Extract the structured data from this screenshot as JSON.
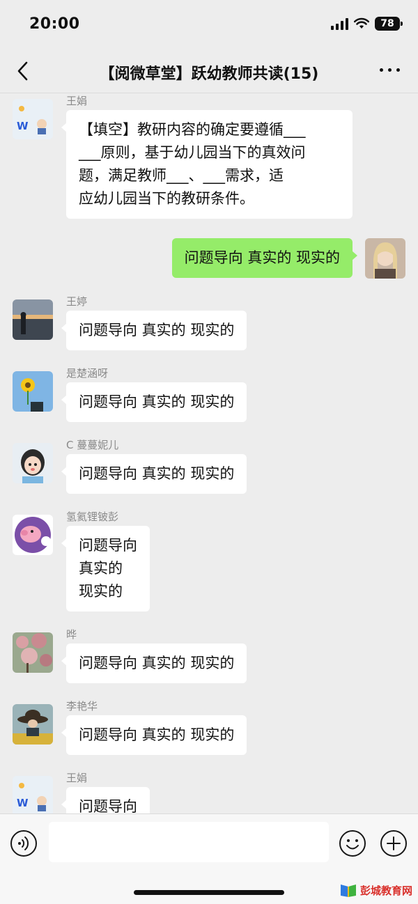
{
  "status_bar": {
    "time": "20:00",
    "battery": "78"
  },
  "nav": {
    "title": "【阅微草堂】跃幼教师共读(15)"
  },
  "messages": [
    {
      "sender": "王娟",
      "text": "【填空】教研内容的确定要遵循___\n___原则，基于幼儿园当下的真效问\n题，满足教师___、___需求，适\n应幼儿园当下的教研条件。"
    },
    {
      "sender": "",
      "text": "问题导向 真实的 现实的"
    },
    {
      "sender": "王婷",
      "text": "问题导向 真实的 现实的"
    },
    {
      "sender": "是楚涵呀",
      "text": "问题导向 真实的 现实的"
    },
    {
      "sender": "C 蔓蔓妮儿",
      "text": "问题导向 真实的 现实的"
    },
    {
      "sender": "氢氦锂铍彭",
      "text": "问题导向\n真实的\n现实的"
    },
    {
      "sender": "晔",
      "text": "问题导向 真实的 现实的"
    },
    {
      "sender": "李艳华",
      "text": "问题导向 真实的 现实的"
    },
    {
      "sender": "王娟",
      "text": "问题导向"
    }
  ],
  "watermark": "彭城教育网",
  "icons": {
    "back": "chevron-left-icon",
    "more": "more-dots-icon",
    "voice": "voice-icon",
    "emoji": "emoji-icon",
    "plus": "plus-icon"
  },
  "colors": {
    "self_bubble": "#95ec69",
    "other_bubble": "#ffffff",
    "background": "#ededed"
  }
}
